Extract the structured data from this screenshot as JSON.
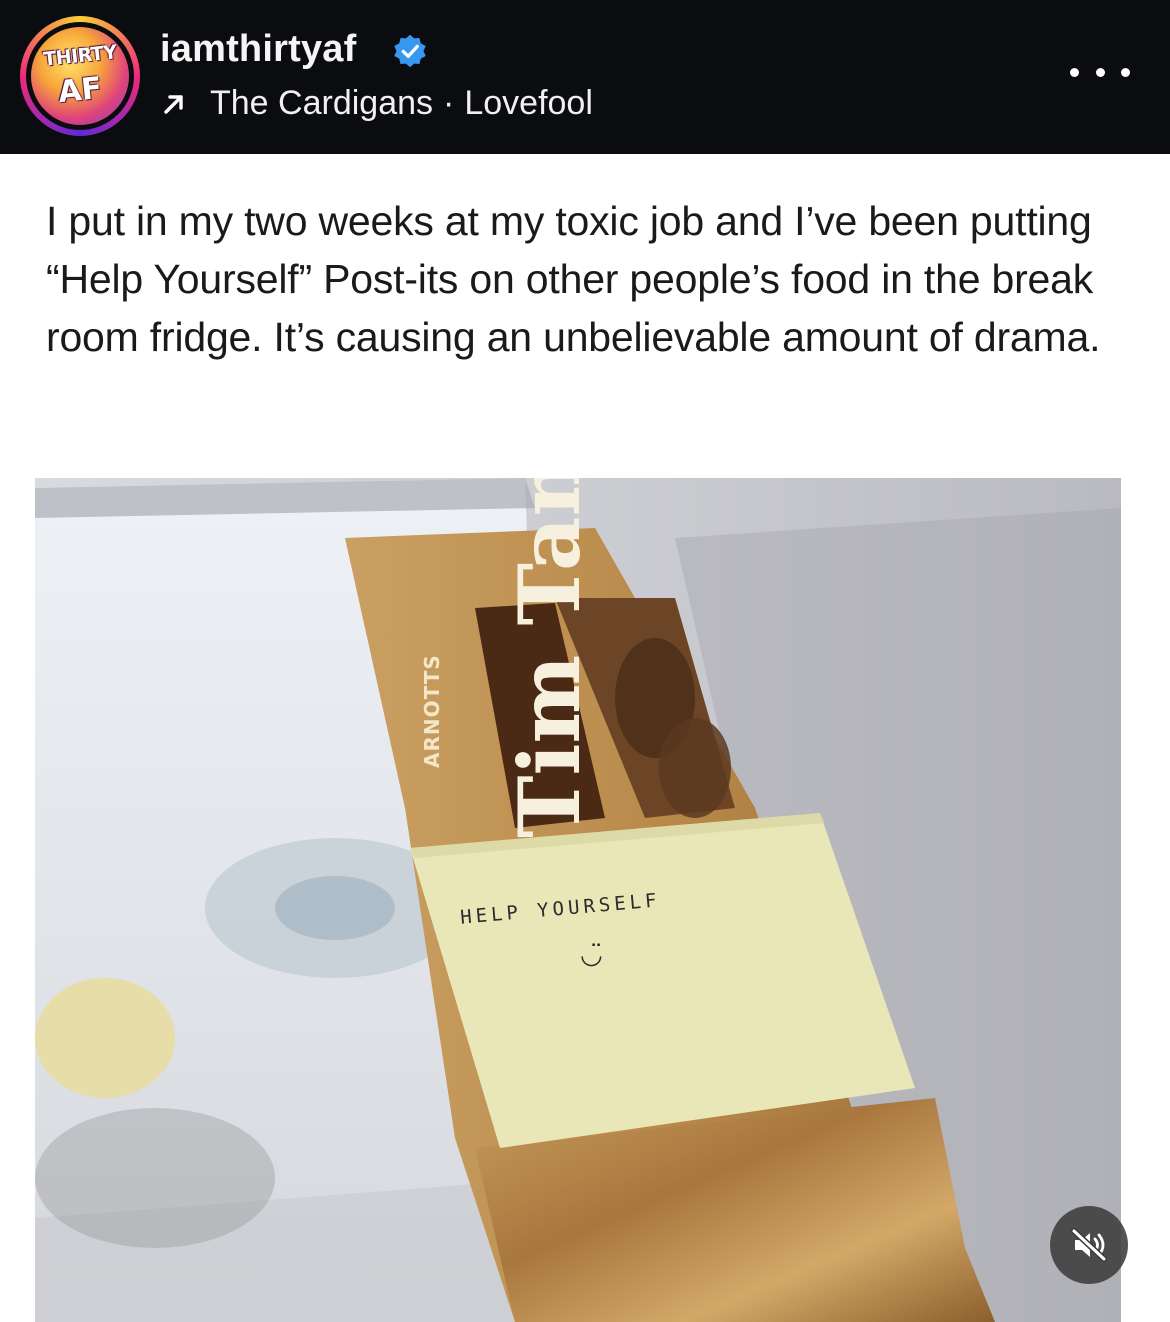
{
  "header": {
    "avatar": {
      "text_top": "THIRTY",
      "text_bottom": "AF"
    },
    "username": "iamthirtyaf",
    "verified_icon": "verified-badge-icon",
    "music": {
      "icon": "arrow-up-right-icon",
      "artist": "The Cardigans",
      "separator": "·",
      "song": "Lovefool"
    },
    "more_icon": "more-horizontal-icon"
  },
  "post": {
    "caption": "I put in my two weeks at my toxic job and I’ve been putting “Help Yourself” Post-its on other people’s food in the break room fridge. It’s causing an unbelievable amount of drama.",
    "photo": {
      "package_brand": "ARNOTTS",
      "package_name": "Tim Tam",
      "postit_text": "HELP YOURSELF",
      "postit_smiley": "◡̈"
    },
    "mute_icon": "speaker-muted-icon"
  },
  "colors": {
    "header_bg": "#0b0c0f",
    "verified_blue": "#3897f0",
    "caption_text": "#1a1a1a",
    "package_gold": "#b8894a",
    "postit": "#e9e6b8"
  }
}
